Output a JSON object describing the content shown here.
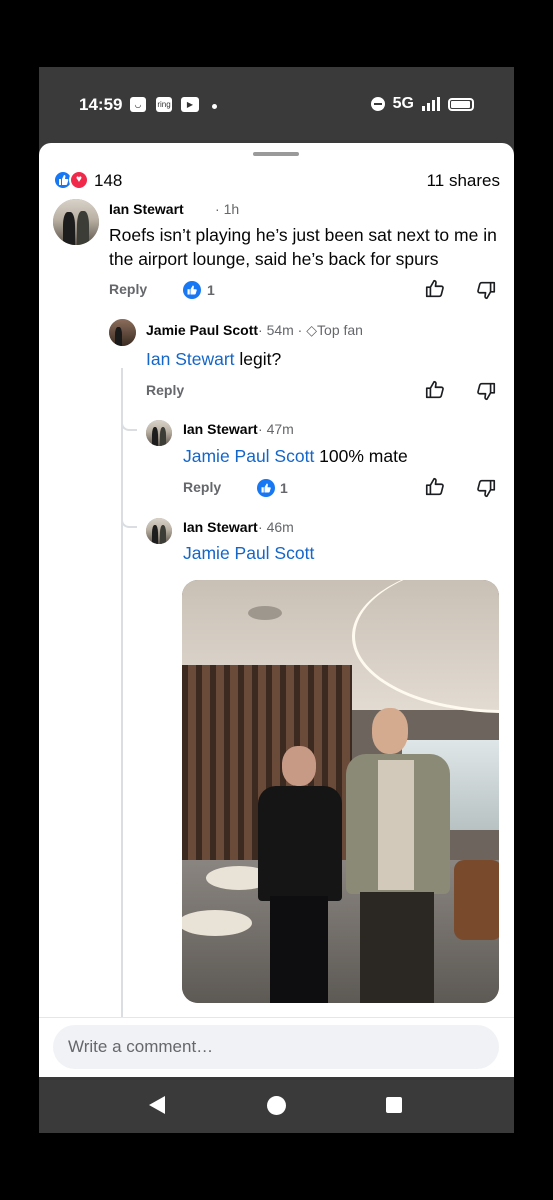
{
  "status_bar": {
    "time": "14:59",
    "network": "5G",
    "notif_icon_2": "ring"
  },
  "reactions": {
    "count": "148",
    "shares": "11 shares"
  },
  "comments": [
    {
      "name": "Ian Stewart",
      "time": "1h",
      "text": "Roefs isn’t playing he’s just been sat next to me in the airport lounge, said he’s back for spurs",
      "reply": "Reply",
      "likes": "1"
    },
    {
      "name": "Jamie Paul Scott",
      "time": "54m",
      "badge": "Top fan",
      "mention": "Ian Stewart",
      "text": " legit?",
      "reply": "Reply"
    },
    {
      "name": "Ian Stewart",
      "time": "47m",
      "mention": "Jamie Paul Scott",
      "text": " 100% mate",
      "reply": "Reply",
      "likes": "1"
    },
    {
      "name": "Ian Stewart",
      "time": "46m",
      "mention": "Jamie Paul Scott"
    }
  ],
  "composer": {
    "placeholder": "Write a comment…"
  },
  "icons": {
    "like": "like-icon",
    "dislike": "dislike-icon",
    "back": "back-icon",
    "home": "home-icon",
    "recents": "recents-icon"
  },
  "colors": {
    "accent": "#1877f2",
    "mention": "#1466c8",
    "heart": "#f0284a"
  }
}
